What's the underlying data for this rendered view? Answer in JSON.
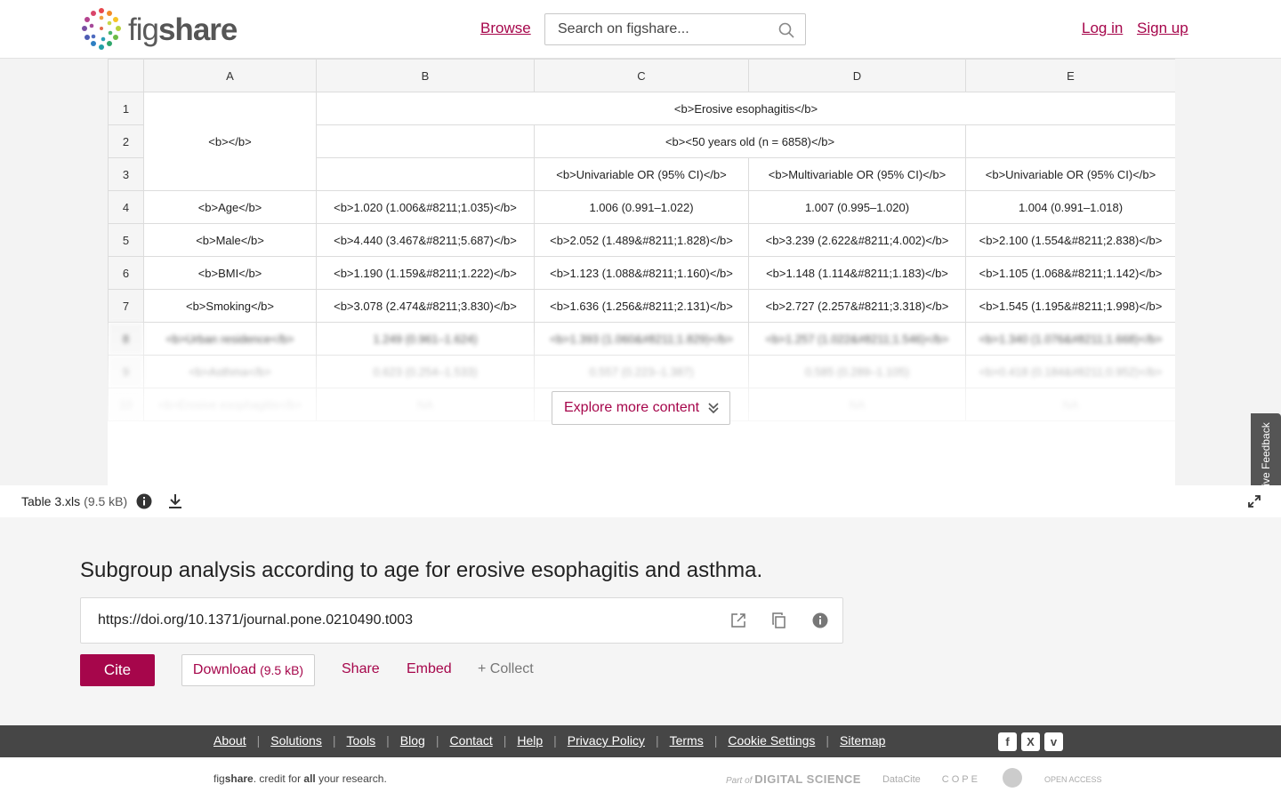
{
  "header": {
    "logo_text_light": "fig",
    "logo_text_bold": "share",
    "browse": "Browse",
    "search_placeholder": "Search on figshare...",
    "login": "Log in",
    "signup": "Sign up"
  },
  "sheet": {
    "columns": [
      "A",
      "B",
      "C",
      "D",
      "E"
    ],
    "row1": {
      "num": "1",
      "a": "<b></b>",
      "bc": "<b>Erosive esophagitis</b>"
    },
    "row2": {
      "num": "2",
      "b": "",
      "cd": "<b><50 years old (n = 6858)</b>",
      "e": ""
    },
    "row3": {
      "num": "3",
      "b": "",
      "c": "<b>Univariable OR (95% CI)</b>",
      "d": "<b>Multivariable OR (95% CI)</b>",
      "e": "<b>Univariable OR (95% CI)</b>"
    },
    "rows": [
      {
        "num": "4",
        "a": "<b>Age</b>",
        "b": "<b>1.020 (1.006&#8211;1.035)</b>",
        "c": "1.006 (0.991–1.022)",
        "d": "1.007 (0.995–1.020)",
        "e": "1.004 (0.991–1.018)"
      },
      {
        "num": "5",
        "a": "<b>Male</b>",
        "b": "<b>4.440 (3.467&#8211;5.687)</b>",
        "c": "<b>2.052 (1.489&#8211;1.828)</b>",
        "d": "<b>3.239 (2.622&#8211;4.002)</b>",
        "e": "<b>2.100 (1.554&#8211;2.838)</b>"
      },
      {
        "num": "6",
        "a": "<b>BMI</b>",
        "b": "<b>1.190 (1.159&#8211;1.222)</b>",
        "c": "<b>1.123 (1.088&#8211;1.160)</b>",
        "d": "<b>1.148 (1.114&#8211;1.183)</b>",
        "e": "<b>1.105 (1.068&#8211;1.142)</b>"
      },
      {
        "num": "7",
        "a": "<b>Smoking</b>",
        "b": "<b>3.078 (2.474&#8211;3.830)</b>",
        "c": "<b>1.636 (1.256&#8211;2.131)</b>",
        "d": "<b>2.727 (2.257&#8211;3.318)</b>",
        "e": "<b>1.545 (1.195&#8211;1.998)</b>"
      },
      {
        "num": "8",
        "a": "<b>Urban residence</b>",
        "b": "1.249 (0.961–1.624)",
        "c": "<b>1.393 (1.060&#8211;1.829)</b>",
        "d": "<b>1.257 (1.022&#8211;1.546)</b>",
        "e": "<b>1.340 (1.076&#8211;1.668)</b>"
      },
      {
        "num": "9",
        "a": "<b>Asthma</b>",
        "b": "0.623 (0.254–1.533)",
        "c": "0.557 (0.223–1.387)",
        "d": "0.585 (0.289–1.105)",
        "e": "<b>0.418 (0.184&#8211;0.952)</b>"
      },
      {
        "num": "10",
        "a": "<b>Erosive esophagitis</b>",
        "b": "NA",
        "c": "NA",
        "d": "NA",
        "e": "NA"
      }
    ]
  },
  "viewer": {
    "explore_label": "Explore more content",
    "feedback_label": "Give Feedback",
    "file_name": "Table 3.xls",
    "file_size": "(9.5 kB)"
  },
  "meta": {
    "title": "Subgroup analysis according to age for erosive esophagitis and asthma.",
    "doi": "https://doi.org/10.1371/journal.pone.0210490.t003",
    "cite": "Cite",
    "download": "Download",
    "download_size": "(9.5 kB)",
    "share": "Share",
    "embed": "Embed",
    "collect": "+ Collect"
  },
  "footer": {
    "links": [
      "About",
      "Solutions",
      "Tools",
      "Blog",
      "Contact",
      "Help",
      "Privacy Policy",
      "Terms",
      "Cookie Settings",
      "Sitemap"
    ],
    "social": [
      "f",
      "X",
      "v"
    ],
    "tagline_fig": "fig",
    "tagline_share": "share",
    "tagline_mid": ". credit for ",
    "tagline_all": "all",
    "tagline_end": " your research.",
    "partner_part_of": "Part of",
    "partner_ds": "DIGITAL SCIENCE",
    "partner_datacite": "DataCite",
    "partner_cope": "COPE",
    "partner_oa": "OPEN ACCESS"
  },
  "colors": {
    "brand": "#a6064b",
    "footer_dark": "#464646"
  }
}
